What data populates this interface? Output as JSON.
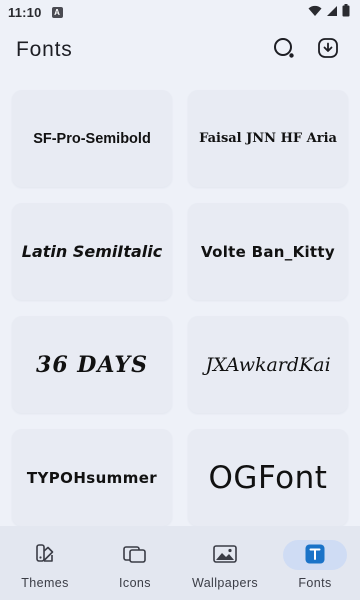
{
  "status_bar": {
    "time": "11:10",
    "notification_letter": "A"
  },
  "header": {
    "title": "Fonts",
    "search_icon": "search-icon",
    "download_icon": "download-icon"
  },
  "fonts": [
    {
      "label": "SF-Pro-Semibold"
    },
    {
      "label": "Faisal JNN HF Aria"
    },
    {
      "label": "Latin SemiItalic"
    },
    {
      "label": "Volte Ban_Kitty"
    },
    {
      "label": "36 DAYS"
    },
    {
      "label": "JXAwkardKai"
    },
    {
      "label": "TYPOHsummer"
    },
    {
      "label": "OGFont"
    }
  ],
  "bottom_nav": {
    "items": [
      {
        "label": "Themes",
        "icon": "themes-icon"
      },
      {
        "label": "Icons",
        "icon": "icons-icon"
      },
      {
        "label": "Wallpapers",
        "icon": "wallpapers-icon"
      },
      {
        "label": "Fonts",
        "icon": "fonts-icon"
      }
    ],
    "active": "Fonts",
    "active_color": "#cfdcf4",
    "accent_color": "#1a73c8"
  }
}
